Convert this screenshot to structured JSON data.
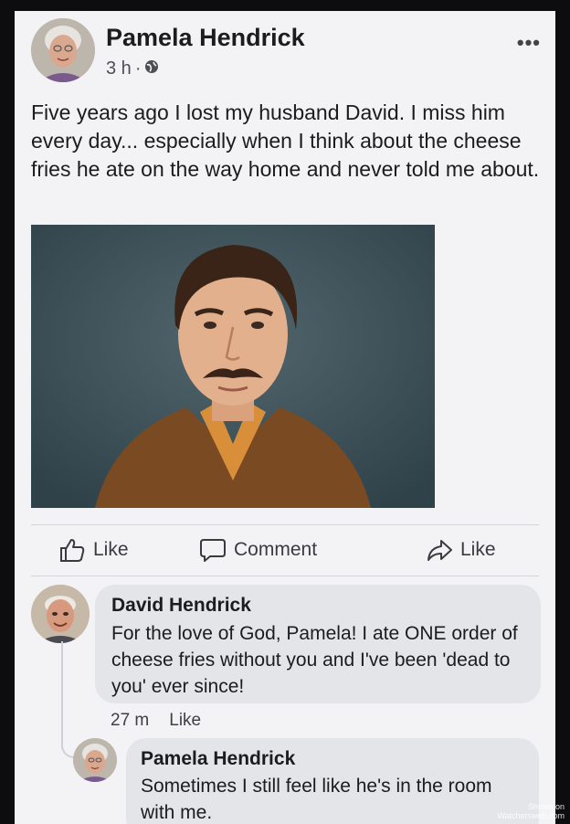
{
  "post": {
    "author": "Pamela Hendrick",
    "time": "3 h",
    "separator": "·",
    "privacy_icon": "globe-icon",
    "more_icon": "more-options-icon",
    "more_label": "•••",
    "text": "Five years ago I lost my husband David. I miss him every day... especially when I think about the cheese fries he ate on the way home and never told me about.",
    "photo": "portrait-of-man-with-mustache"
  },
  "actions": [
    {
      "icon": "thumbs-up-icon",
      "label": "Like"
    },
    {
      "icon": "comment-icon",
      "label": "Comment"
    },
    {
      "icon": "share-icon",
      "label": "Like"
    }
  ],
  "comments": [
    {
      "author": "David Hendrick",
      "text": "For the love of God, Pamela! I ate ONE order of cheese fries without you and I've been 'dead to you' ever since!",
      "time": "27 m",
      "like_label": "Like"
    },
    {
      "author": "Pamela Hendrick",
      "text": "Sometimes I still feel like he's in the room with me."
    }
  ],
  "watermark": {
    "line1": "Shown on",
    "line2": "Watchersweb.com"
  },
  "colors": {
    "card_bg": "#f3f3f5",
    "bubble_bg": "#e4e5e9",
    "frame_bg": "#0d0d0f",
    "text": "#1c1c1e"
  }
}
